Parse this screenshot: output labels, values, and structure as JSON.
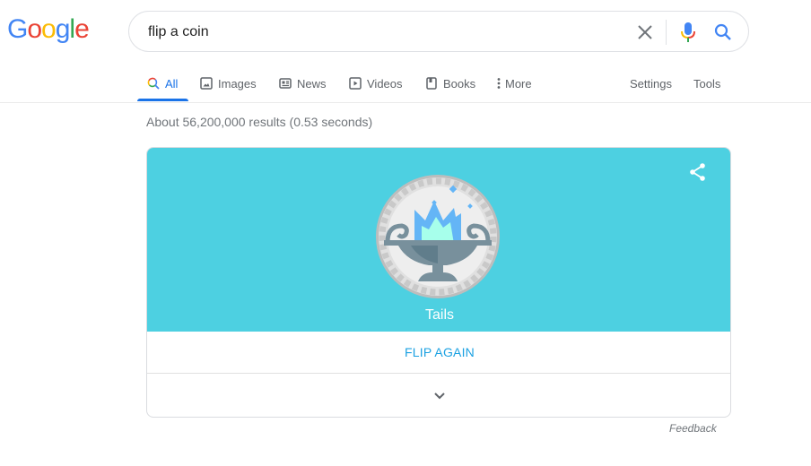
{
  "logo": {
    "letters": [
      "G",
      "o",
      "o",
      "g",
      "l",
      "e"
    ],
    "colors": [
      "#4285f4",
      "#ea4335",
      "#fbbc05",
      "#4285f4",
      "#34a853",
      "#ea4335"
    ]
  },
  "search": {
    "query": "flip a coin",
    "clear_icon": "close-icon",
    "mic_icon": "microphone-icon",
    "search_icon": "search-icon"
  },
  "tabs": [
    {
      "label": "All",
      "icon": "search-icon",
      "active": true
    },
    {
      "label": "Images",
      "icon": "image-icon",
      "active": false
    },
    {
      "label": "News",
      "icon": "newspaper-icon",
      "active": false
    },
    {
      "label": "Videos",
      "icon": "play-icon",
      "active": false
    },
    {
      "label": "Books",
      "icon": "book-icon",
      "active": false
    },
    {
      "label": "More",
      "icon": "more-vertical-icon",
      "active": false
    }
  ],
  "tools": {
    "settings_label": "Settings",
    "tools_label": "Tools"
  },
  "result_stats": "About 56,200,000 results (0.53 seconds)",
  "coin_card": {
    "result_label": "Tails",
    "flip_again_label": "FLIP AGAIN",
    "share_icon": "share-icon",
    "expand_icon": "chevron-down-icon",
    "colors": {
      "background": "#4dd0e1",
      "button_text": "#1ba1e2"
    }
  },
  "feedback_label": "Feedback"
}
